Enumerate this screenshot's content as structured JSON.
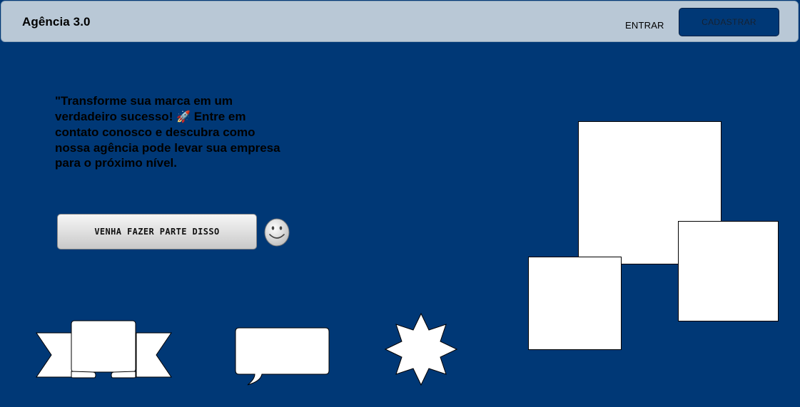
{
  "header": {
    "brand": "Agência 3.0",
    "login_label": "ENTRAR",
    "signup_label": "CADASTRAR"
  },
  "hero": {
    "text_before": "\"Transforme sua marca em um verdadeiro sucesso! ",
    "emoji": "🚀",
    "text_after": " Entre em contato conosco e descubra como nossa agência pode levar sua empresa para o próximo nível.",
    "cta_label": "VENHA FAZER PARTE DISSO"
  },
  "colors": {
    "background": "#003876",
    "navbar": "#b9c8d6",
    "shapes": "#ffffff"
  },
  "icons": {
    "smiley": "smiley-icon",
    "rocket": "rocket-emoji"
  }
}
